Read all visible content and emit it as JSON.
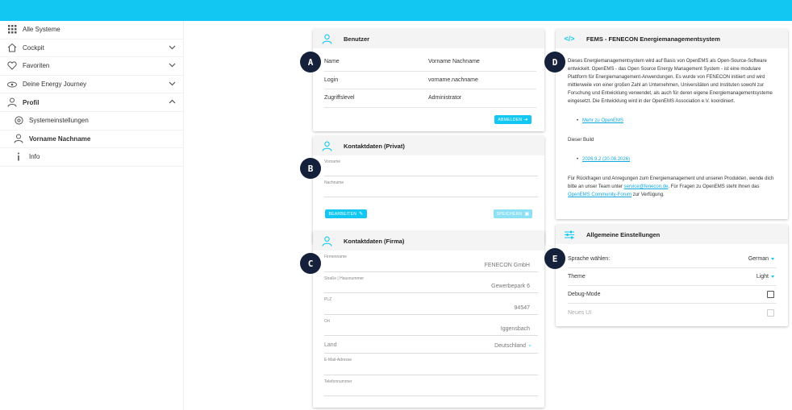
{
  "sidebar": {
    "items": [
      {
        "label": "Alle Systeme",
        "icon": "grid-icon"
      },
      {
        "label": "Cockpit",
        "icon": "home-icon"
      },
      {
        "label": "Favoriten",
        "icon": "heart-icon"
      },
      {
        "label": "Deine Energy Journey",
        "icon": "eye-icon"
      },
      {
        "label": "Profil",
        "icon": "user-icon"
      },
      {
        "label": "Systemeinstellungen",
        "icon": "settings-icon"
      },
      {
        "label": "Vorname Nachname",
        "icon": "user-icon"
      },
      {
        "label": "Info",
        "icon": "info-icon"
      }
    ]
  },
  "benutzer": {
    "title": "Benutzer",
    "rows": [
      {
        "key": "Name",
        "value": "Vorname Nachname"
      },
      {
        "key": "Login",
        "value": "vorname.nachname"
      },
      {
        "key": "Zugriffslevel",
        "value": "Administrator"
      }
    ],
    "logout_label": "ABMELDEN"
  },
  "privat": {
    "title": "Kontaktdaten (Privat)",
    "fields": [
      {
        "label": "Vorname",
        "value": ""
      },
      {
        "label": "Nachname",
        "value": ""
      }
    ],
    "edit_label": "BEARBEITEN",
    "save_label": "SPEICHERN"
  },
  "firma": {
    "title": "Kontaktdaten (Firma)",
    "fields": [
      {
        "label": "Firmenname",
        "value": "FENECON GmbH"
      },
      {
        "label": "Straße | Hausnummer",
        "value": "Gewerbepark 6"
      },
      {
        "label": "PLZ",
        "value": "94547"
      },
      {
        "label": "Ort",
        "value": "Iggensbach"
      },
      {
        "label": "Land",
        "value": "Deutschland"
      },
      {
        "label": "E-Mail-Adresse",
        "value": ""
      },
      {
        "label": "Telefonnummer",
        "value": ""
      }
    ]
  },
  "fems": {
    "title": "FEMS - FENECON Energiemanagementsystem",
    "paragraph": "Dieses Energiemanagementsystem wird auf Basis von OpenEMS als Open-Source-Software entwickelt. OpenEMS - das Open Source Energy Management System - ist eine modulare Plattform für Energiemanagement-Anwendungen. Es wurde von FENECON initiiert und wird mittlerweile von einer großen Zahl an Unternehmen, Universitäten und Instituten sowohl zur Forschung und Entwicklung verwendet, als auch für deren eigene Energiemanagementsysteme eingesetzt. Die Entwicklung wird in der OpenEMS Association e.V. koordiniert.",
    "more_link": "Mehr zu OpenEMS",
    "build_label": "Dieser Build",
    "build_link": "2026.9.2 (20.08.2026)",
    "contact_pre": "Für Rückfragen und Anregungen zum Energiemanagement und unseren Produkten, wende dich bitte an unser Team unter ",
    "contact_email": "service@fenecon.de",
    "contact_mid": ". Für Fragen zu OpenEMS steht Ihnen das ",
    "contact_forum": "OpenEMS Community-Forum",
    "contact_post": " zur Verfügung."
  },
  "settings": {
    "title": "Allgemeine Einstellungen",
    "rows": [
      {
        "label": "Sprache wählen:",
        "value": "German",
        "type": "select"
      },
      {
        "label": "Theme",
        "value": "Light",
        "type": "select"
      },
      {
        "label": "Debug-Mode",
        "type": "checkbox",
        "checked": false
      },
      {
        "label": "Neues UI",
        "type": "checkbox",
        "checked": false,
        "disabled": true
      }
    ]
  },
  "markers": [
    "A",
    "B",
    "C",
    "D",
    "E"
  ],
  "colors": {
    "accent": "#12c8f2",
    "marker": "#15203a"
  }
}
